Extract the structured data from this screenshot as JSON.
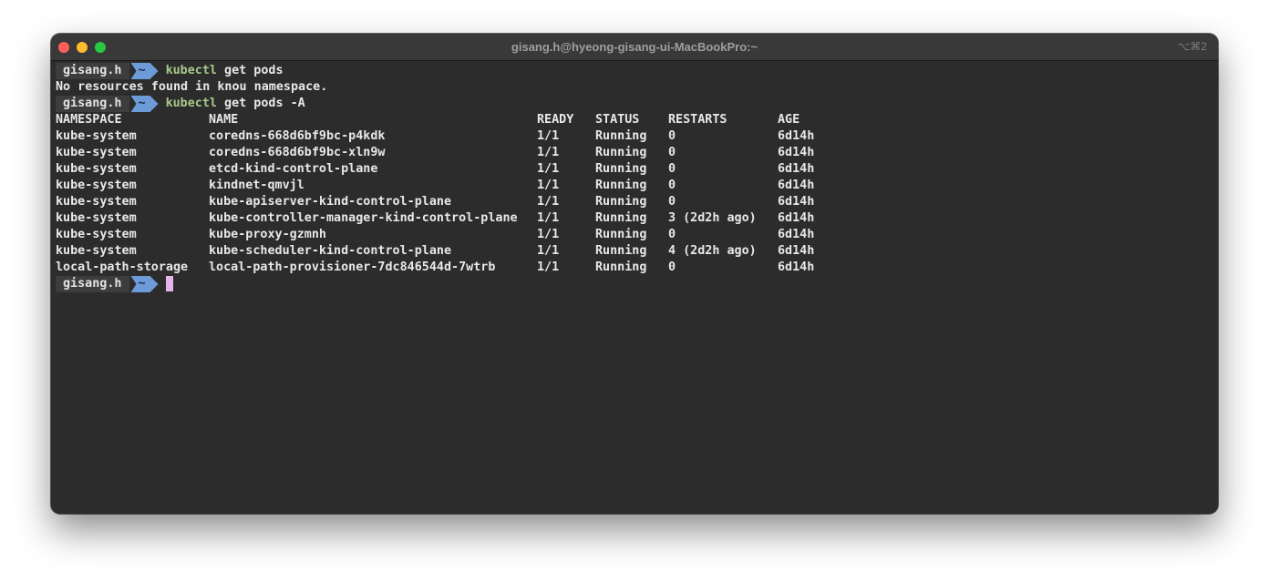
{
  "window": {
    "title": "gisang.h@hyeong-gisang-ui-MacBookPro:~",
    "shortcut": "⌥⌘2"
  },
  "prompt": {
    "user": "gisang.h",
    "dir": "~"
  },
  "commands": [
    {
      "cmd": "kubectl",
      "args": " get pods"
    },
    {
      "cmd": "kubectl",
      "args": " get pods -A"
    }
  ],
  "output_message": "No resources found in knou namespace.",
  "table": {
    "headers": [
      "NAMESPACE",
      "NAME",
      "READY",
      "STATUS",
      "RESTARTS",
      "AGE"
    ],
    "rows": [
      [
        "kube-system",
        "coredns-668d6bf9bc-p4kdk",
        "1/1",
        "Running",
        "0",
        "6d14h"
      ],
      [
        "kube-system",
        "coredns-668d6bf9bc-xln9w",
        "1/1",
        "Running",
        "0",
        "6d14h"
      ],
      [
        "kube-system",
        "etcd-kind-control-plane",
        "1/1",
        "Running",
        "0",
        "6d14h"
      ],
      [
        "kube-system",
        "kindnet-qmvjl",
        "1/1",
        "Running",
        "0",
        "6d14h"
      ],
      [
        "kube-system",
        "kube-apiserver-kind-control-plane",
        "1/1",
        "Running",
        "0",
        "6d14h"
      ],
      [
        "kube-system",
        "kube-controller-manager-kind-control-plane",
        "1/1",
        "Running",
        "3 (2d2h ago)",
        "6d14h"
      ],
      [
        "kube-system",
        "kube-proxy-gzmnh",
        "1/1",
        "Running",
        "0",
        "6d14h"
      ],
      [
        "kube-system",
        "kube-scheduler-kind-control-plane",
        "1/1",
        "Running",
        "4 (2d2h ago)",
        "6d14h"
      ],
      [
        "local-path-storage",
        "local-path-provisioner-7dc846544d-7wtrb",
        "1/1",
        "Running",
        "0",
        "6d14h"
      ]
    ]
  },
  "colors": {
    "terminal_bg": "#2c2c2c",
    "prompt_dir_bg": "#6c9bd8",
    "command": "#a8c98a",
    "cursor": "#e6b3ea"
  }
}
